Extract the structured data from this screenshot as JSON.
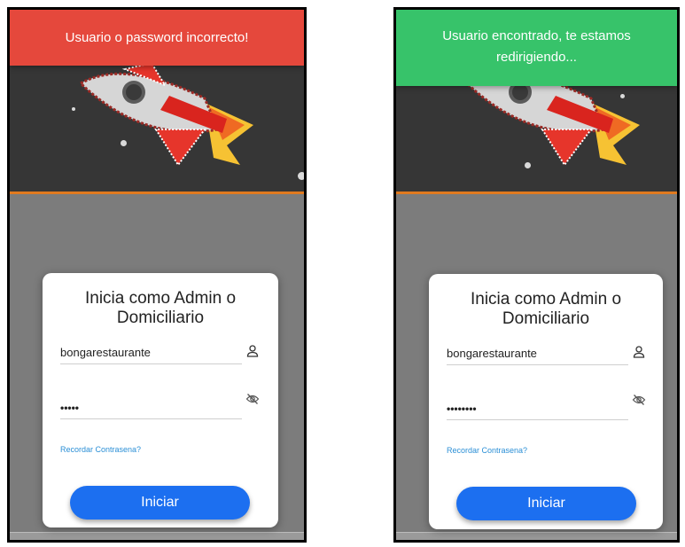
{
  "screens": [
    {
      "toast": {
        "message": "Usuario o password incorrecto!",
        "color": "#e5483c",
        "status": "error"
      },
      "card": {
        "title": "Inicia como Admin o Domiciliario",
        "username_value": "bongarestaurante",
        "password_value": "•••••",
        "forgot_link": "Recordar Contrasena?",
        "submit_label": "Iniciar"
      }
    },
    {
      "toast": {
        "message": "Usuario encontrado, te estamos redirigiendo...",
        "color": "#37c36a",
        "status": "success"
      },
      "card": {
        "title": "Inicia como Admin o Domiciliario",
        "username_value": "bongarestaurante",
        "password_value": "••••••••",
        "forgot_link": "Recordar Contrasena?",
        "submit_label": "Iniciar"
      }
    }
  ],
  "icons": {
    "rocket": "rocket-icon",
    "user": "user-icon",
    "visibility": "eye-off-icon"
  },
  "colors": {
    "hero_bg": "#363636",
    "accent_line": "#e07a1f",
    "button": "#1c6ff0",
    "link": "#2b8fd6"
  }
}
